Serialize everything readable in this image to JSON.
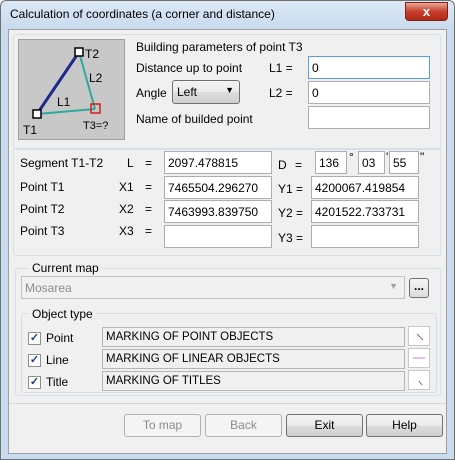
{
  "window": {
    "title": "Calculation of coordinates (a corner and distance)",
    "close_glyph": "x"
  },
  "diagram": {
    "labels": {
      "t1": "T1",
      "t2": "T2",
      "t3": "T3=?",
      "l1": "L1",
      "l2": "L2"
    },
    "colors": {
      "line_t1_t2": "#1e2a8c",
      "line_l1": "#2ea89a",
      "line_l2": "#2ea89a",
      "target_marker": "#d21e1e"
    }
  },
  "building": {
    "header": "Building parameters of point T3",
    "distance_label": "Distance up to point",
    "l1_label": "L1 =",
    "l1_value": "0",
    "angle_label": "Angle",
    "angle_value": "Left",
    "l2_label": "L2 =",
    "l2_value": "0",
    "name_label": "Name of builded point",
    "name_value": ""
  },
  "segment": {
    "label": "Segment T1-T2",
    "l_label": "L",
    "eq": "=",
    "l_value": "2097.478815",
    "d_label": "D",
    "deg": "136",
    "deg_sym": "°",
    "min": "03",
    "min_sym": "'",
    "sec": "55",
    "sec_sym": "\""
  },
  "points": [
    {
      "label": "Point T1",
      "x_label": "X1",
      "x_value": "7465504.296270",
      "y_label": "Y1 =",
      "y_value": "4200067.419854"
    },
    {
      "label": "Point T2",
      "x_label": "X2",
      "x_value": "7463993.839750",
      "y_label": "Y2 =",
      "y_value": "4201522.733731"
    },
    {
      "label": "Point T3",
      "x_label": "X3",
      "x_value": "",
      "y_label": "Y3 =",
      "y_value": ""
    }
  ],
  "current_map": {
    "header": "Current map",
    "value": "Mosarea",
    "browse_label": "..."
  },
  "object_type": {
    "header": "Object type",
    "items": [
      {
        "label": "Point",
        "checked": "✓",
        "value": "MARKING OF POINT OBJECTS"
      },
      {
        "label": "Line",
        "checked": "✓",
        "value": "MARKING OF LINEAR OBJECTS"
      },
      {
        "label": "Title",
        "checked": "✓",
        "value": "MARKING OF TITLES"
      }
    ]
  },
  "buttons": {
    "to_map": "To map",
    "back": "Back",
    "exit": "Exit",
    "help": "Help"
  }
}
